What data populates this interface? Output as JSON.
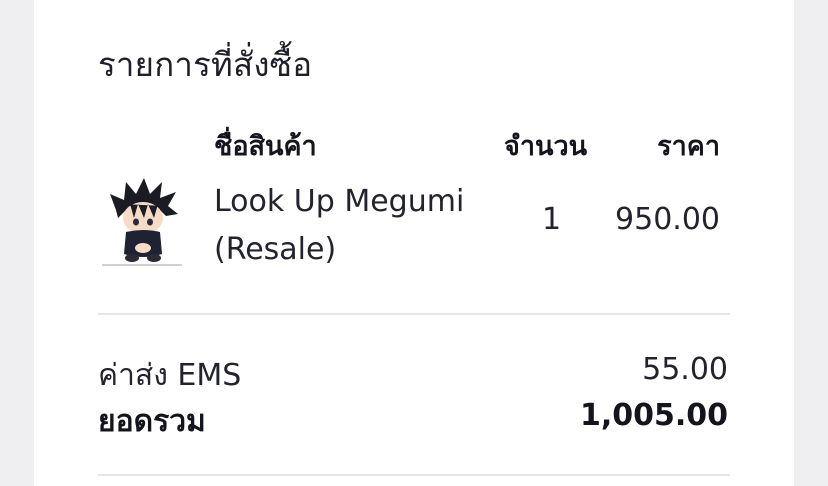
{
  "order": {
    "title": "รายการที่สั่งซื้อ",
    "columns": {
      "name": "ชื่อสินค้า",
      "qty": "จำนวน",
      "price": "ราคา"
    },
    "items": [
      {
        "name_line1": "Look Up Megumi",
        "name_line2": "(Resale)",
        "qty": "1",
        "price": "950.00",
        "thumbnail": "figure-thumbnail-icon"
      }
    ],
    "shipping_label": "ค่าส่ง EMS",
    "shipping_value": "55.00",
    "total_label": "ยอดรวม",
    "total_value": "1,005.00"
  }
}
